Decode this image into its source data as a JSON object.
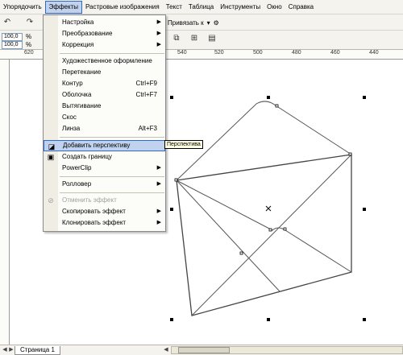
{
  "menubar": {
    "items": [
      "Упорядочить",
      "Эффекты",
      "Растровые изображения",
      "Текст",
      "Таблица",
      "Инструменты",
      "Окно",
      "Справка"
    ],
    "active_index": 1
  },
  "toolbar": {
    "snap_label": "Привязать к",
    "value1": "100,0",
    "value2": "100,0",
    "pct": "%"
  },
  "ruler": {
    "h_ticks": [
      "620",
      "540",
      "520",
      "500",
      "480",
      "460",
      "440"
    ]
  },
  "menu": {
    "items": [
      {
        "label": "Настройка",
        "submenu": true
      },
      {
        "label": "Преобразование",
        "submenu": true
      },
      {
        "label": "Коррекция",
        "submenu": true
      },
      {
        "label": "Художественное оформление"
      },
      {
        "label": "Перетекание"
      },
      {
        "label": "Контур",
        "shortcut": "Ctrl+F9"
      },
      {
        "label": "Оболочка",
        "shortcut": "Ctrl+F7"
      },
      {
        "label": "Вытягивание"
      },
      {
        "label": "Скос"
      },
      {
        "label": "Линза",
        "shortcut": "Alt+F3"
      },
      {
        "label": "Добавить перспективу",
        "highlighted": true
      },
      {
        "label": "Создать границу"
      },
      {
        "label": "PowerClip",
        "submenu": true
      },
      {
        "label": "Ролловер",
        "submenu": true
      },
      {
        "label": "Отменить эффект",
        "disabled": true
      },
      {
        "label": "Скопировать эффект",
        "submenu": true
      },
      {
        "label": "Клонировать эффект",
        "submenu": true
      }
    ]
  },
  "tooltip": {
    "text": "Перспектива"
  },
  "status": {
    "page_tab": "Страница 1"
  },
  "colors": {
    "highlight": "#c1d2ee",
    "highlight_border": "#316ac5",
    "menu_bg": "#fcfcf9"
  }
}
